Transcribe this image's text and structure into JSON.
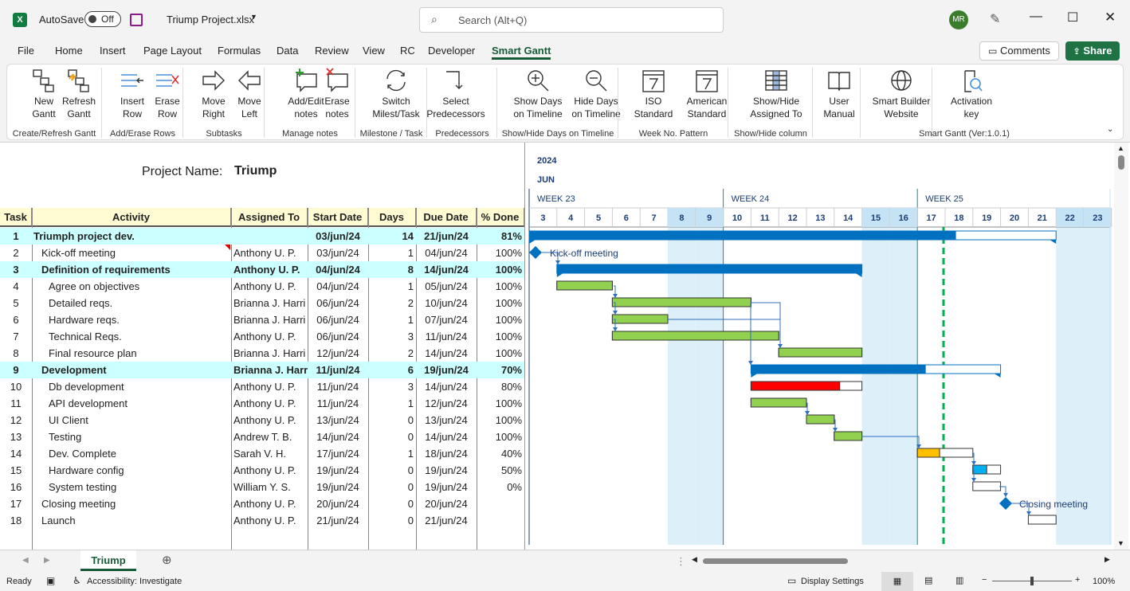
{
  "titlebar": {
    "autosave_label": "AutoSave",
    "autosave_state": "Off",
    "filename": "Triump Project.xlsx",
    "search_placeholder": "Search (Alt+Q)",
    "avatar_initials": "MR"
  },
  "tabs": [
    "File",
    "Home",
    "Insert",
    "Page Layout",
    "Formulas",
    "Data",
    "Review",
    "View",
    "RC",
    "Developer",
    "Smart Gantt"
  ],
  "active_tab": "Smart Gantt",
  "comments_label": "Comments",
  "share_label": "Share",
  "ribbon": {
    "buttons": [
      {
        "l1": "New",
        "l2": "Gantt",
        "icon": "new-gantt-icon"
      },
      {
        "l1": "Refresh",
        "l2": "Gantt",
        "icon": "refresh-gantt-icon"
      },
      {
        "l1": "Insert",
        "l2": "Row",
        "icon": "insert-row-icon"
      },
      {
        "l1": "Erase",
        "l2": "Row",
        "icon": "erase-row-icon"
      },
      {
        "l1": "Move",
        "l2": "Right",
        "icon": "arrow-right-icon"
      },
      {
        "l1": "Move",
        "l2": "Left",
        "icon": "arrow-left-icon"
      },
      {
        "l1": "Add/Edit",
        "l2": "notes",
        "icon": "add-note-icon"
      },
      {
        "l1": "Erase",
        "l2": "notes",
        "icon": "erase-note-icon"
      },
      {
        "l1": "Switch",
        "l2": "Milest/Task",
        "icon": "switch-icon"
      },
      {
        "l1": "Select",
        "l2": "Predecessors",
        "icon": "predecessor-icon"
      },
      {
        "l1": "Show Days",
        "l2": "on Timeline",
        "icon": "zoom-in-icon"
      },
      {
        "l1": "Hide Days",
        "l2": "on Timeline",
        "icon": "zoom-out-icon"
      },
      {
        "l1": "ISO",
        "l2": "Standard",
        "icon": "calendar-7-icon"
      },
      {
        "l1": "American",
        "l2": "Standard",
        "icon": "calendar-7-icon"
      },
      {
        "l1": "Show/Hide",
        "l2": "Assigned To",
        "icon": "column-icon"
      },
      {
        "l1": "User",
        "l2": "Manual",
        "icon": "book-icon"
      },
      {
        "l1": "Smart Builder",
        "l2": "Website",
        "icon": "globe-icon"
      },
      {
        "l1": "Activation",
        "l2": "key",
        "icon": "key-icon"
      }
    ],
    "groups": [
      "Create/Refresh Gantt",
      "Add/Erase Rows",
      "Subtasks",
      "Manage notes",
      "Milestone / Task",
      "Predecessors",
      "Show/Hide Days on Timeline",
      "Week No. Pattern",
      "Show/Hide column",
      "Smart Gantt (Ver:1.0.1)"
    ]
  },
  "sheet": {
    "project_label": "Project Name:",
    "project_name": "Triump",
    "headers": [
      "Task",
      "Activity",
      "Assigned To",
      "Start Date",
      "Days",
      "Due Date",
      "% Done"
    ],
    "year": "2024",
    "month": "JUN",
    "weeks": [
      "WEEK 23",
      "WEEK 24",
      "WEEK 25"
    ],
    "days": [
      "3",
      "4",
      "5",
      "6",
      "7",
      "8",
      "9",
      "10",
      "11",
      "12",
      "13",
      "14",
      "15",
      "16",
      "17",
      "18",
      "19",
      "20",
      "21",
      "22",
      "23"
    ],
    "rows": [
      {
        "task": "1",
        "activity": "Triumph project dev.",
        "assigned": "",
        "start": "03/jun/24",
        "days": "14",
        "due": "21/jun/24",
        "done": "81%",
        "level": 0,
        "summary": true
      },
      {
        "task": "2",
        "activity": "Kick-off meeting",
        "assigned": "Anthony U. P.",
        "start": "03/jun/24",
        "days": "1",
        "due": "04/jun/24",
        "done": "100%",
        "level": 1,
        "summary": false
      },
      {
        "task": "3",
        "activity": "Definition of requirements",
        "assigned": "Anthony U. P.",
        "start": "04/jun/24",
        "days": "8",
        "due": "14/jun/24",
        "done": "100%",
        "level": 1,
        "summary": true
      },
      {
        "task": "4",
        "activity": "Agree on objectives",
        "assigned": "Anthony U. P.",
        "start": "04/jun/24",
        "days": "1",
        "due": "05/jun/24",
        "done": "100%",
        "level": 2,
        "summary": false
      },
      {
        "task": "5",
        "activity": "Detailed reqs.",
        "assigned": "Brianna J. Harri",
        "start": "06/jun/24",
        "days": "2",
        "due": "10/jun/24",
        "done": "100%",
        "level": 2,
        "summary": false
      },
      {
        "task": "6",
        "activity": "Hardware reqs.",
        "assigned": "Brianna J. Harri",
        "start": "06/jun/24",
        "days": "1",
        "due": "07/jun/24",
        "done": "100%",
        "level": 2,
        "summary": false
      },
      {
        "task": "7",
        "activity": "Technical Reqs.",
        "assigned": "Anthony U. P.",
        "start": "06/jun/24",
        "days": "3",
        "due": "11/jun/24",
        "done": "100%",
        "level": 2,
        "summary": false
      },
      {
        "task": "8",
        "activity": "Final resource plan",
        "assigned": "Brianna J. Harri",
        "start": "12/jun/24",
        "days": "2",
        "due": "14/jun/24",
        "done": "100%",
        "level": 2,
        "summary": false
      },
      {
        "task": "9",
        "activity": "Development",
        "assigned": "Brianna J. Harri",
        "start": "11/jun/24",
        "days": "6",
        "due": "19/jun/24",
        "done": "70%",
        "level": 1,
        "summary": true
      },
      {
        "task": "10",
        "activity": "Db development",
        "assigned": "Anthony U. P.",
        "start": "11/jun/24",
        "days": "3",
        "due": "14/jun/24",
        "done": "80%",
        "level": 2,
        "summary": false
      },
      {
        "task": "11",
        "activity": "API development",
        "assigned": "Anthony U. P.",
        "start": "11/jun/24",
        "days": "1",
        "due": "12/jun/24",
        "done": "100%",
        "level": 2,
        "summary": false
      },
      {
        "task": "12",
        "activity": "UI Client",
        "assigned": "Anthony U. P.",
        "start": "13/jun/24",
        "days": "0",
        "due": "13/jun/24",
        "done": "100%",
        "level": 2,
        "summary": false
      },
      {
        "task": "13",
        "activity": "Testing",
        "assigned": "Andrew T. B.",
        "start": "14/jun/24",
        "days": "0",
        "due": "14/jun/24",
        "done": "100%",
        "level": 2,
        "summary": false
      },
      {
        "task": "14",
        "activity": "Dev. Complete",
        "assigned": "Sarah V. H.",
        "start": "17/jun/24",
        "days": "1",
        "due": "18/jun/24",
        "done": "40%",
        "level": 2,
        "summary": false
      },
      {
        "task": "15",
        "activity": "Hardware config",
        "assigned": "Anthony U. P.",
        "start": "19/jun/24",
        "days": "0",
        "due": "19/jun/24",
        "done": "50%",
        "level": 2,
        "summary": false
      },
      {
        "task": "16",
        "activity": "System testing",
        "assigned": "William Y. S.",
        "start": "19/jun/24",
        "days": "0",
        "due": "19/jun/24",
        "done": "0%",
        "level": 2,
        "summary": false
      },
      {
        "task": "17",
        "activity": "Closing meeting",
        "assigned": "Anthony U. P.",
        "start": "20/jun/24",
        "days": "0",
        "due": "20/jun/24",
        "done": "",
        "level": 1,
        "summary": false
      },
      {
        "task": "18",
        "activity": "Launch",
        "assigned": "Anthony U. P.",
        "start": "21/jun/24",
        "days": "0",
        "due": "21/jun/24",
        "done": "",
        "level": 1,
        "summary": false
      }
    ],
    "milestone_labels": [
      "Kick-off meeting",
      "Closing meeting"
    ]
  },
  "sheet_tab": "Triump",
  "status": {
    "ready": "Ready",
    "accessibility": "Accessibility: Investigate",
    "display_settings": "Display Settings",
    "zoom": "100%"
  },
  "colors": {
    "accent": "#185c37",
    "summary_bar": "#0070c0",
    "done_bar": "#92d050",
    "late_bar": "#ff0000",
    "partial_bar": "#ffc000",
    "today_line": "#00b050"
  }
}
